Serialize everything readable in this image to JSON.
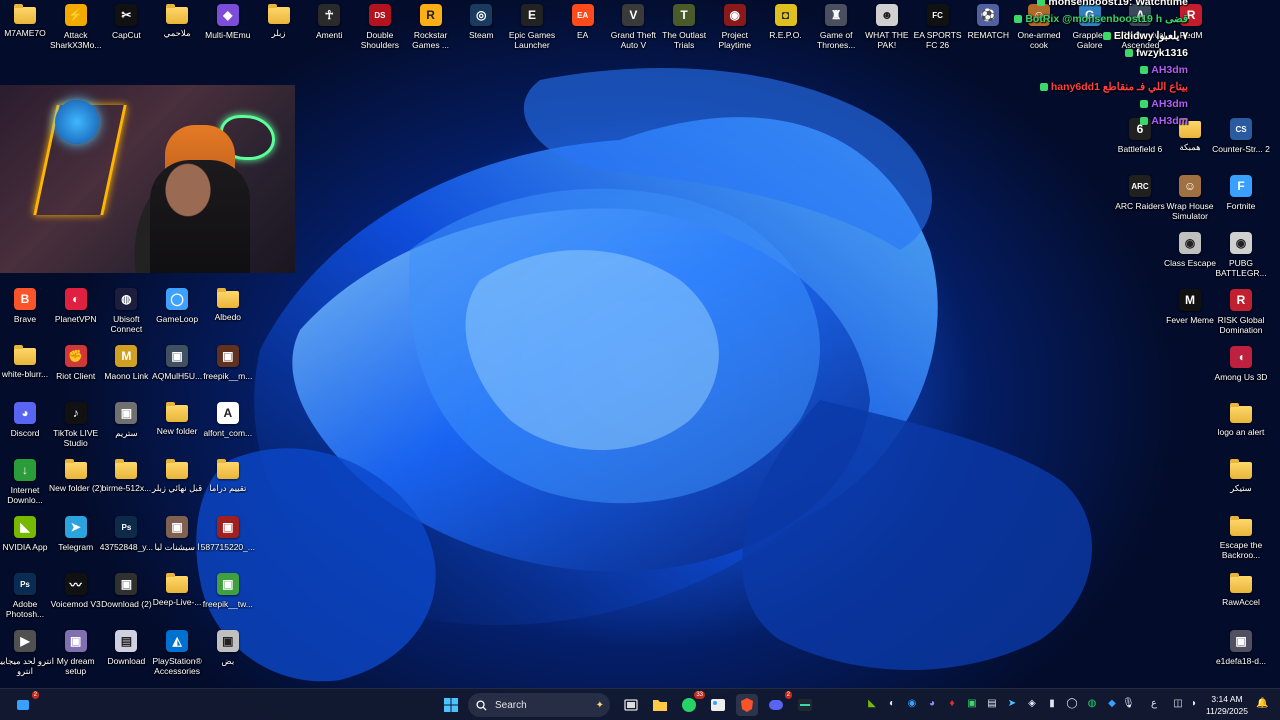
{
  "desktop": {
    "top_row": [
      {
        "label": "M7AME7O",
        "icon": "folder-icon",
        "color": "#f2c14e",
        "glyph": ""
      },
      {
        "label": "Attack SharkX3Mo...",
        "icon": "shark-icon",
        "color": "#f2a900",
        "glyph": "⚡"
      },
      {
        "label": "CapCut",
        "icon": "capcut-icon",
        "color": "#111111",
        "glyph": "✂"
      },
      {
        "label": "ملاحمي",
        "icon": "folder-icon",
        "color": "#f2c14e",
        "glyph": ""
      },
      {
        "label": "Multi-MEmu",
        "icon": "memu-icon",
        "color": "#7b4dd8",
        "glyph": "◆"
      },
      {
        "label": "زبلر",
        "icon": "folder-icon",
        "color": "#f2c14e",
        "glyph": ""
      },
      {
        "label": "Amenti",
        "icon": "game-icon",
        "color": "#2a2a2a",
        "glyph": "☥"
      },
      {
        "label": "Double Shoulders",
        "icon": "ds-icon",
        "color": "#b3121f",
        "glyph": "DS"
      },
      {
        "label": "Rockstar Games ...",
        "icon": "rockstar-icon",
        "color": "#fcaf17",
        "glyph": "R"
      },
      {
        "label": "Steam",
        "icon": "steam-icon",
        "color": "#1b3b5e",
        "glyph": "◎"
      },
      {
        "label": "Epic Games Launcher",
        "icon": "epic-icon",
        "color": "#222222",
        "glyph": "E"
      },
      {
        "label": "EA",
        "icon": "ea-icon",
        "color": "#ff4a1c",
        "glyph": "EA"
      },
      {
        "label": "Grand Theft Auto V",
        "icon": "gta-icon",
        "color": "#3a3a3a",
        "glyph": "V"
      },
      {
        "label": "The Outlast Trials",
        "icon": "outlast-icon",
        "color": "#4a5a2a",
        "glyph": "T"
      },
      {
        "label": "Project Playtime",
        "icon": "playtime-icon",
        "color": "#8a1a1a",
        "glyph": "◉"
      },
      {
        "label": "R.E.P.O.",
        "icon": "repo-icon",
        "color": "#e0c020",
        "glyph": "◘"
      },
      {
        "label": "Game of Thrones...",
        "icon": "got-icon",
        "color": "#4a5060",
        "glyph": "♜"
      },
      {
        "label": "WHAT THE PAK!",
        "icon": "pak-icon",
        "color": "#d0d0d0",
        "glyph": "☻"
      },
      {
        "label": "EA SPORTS FC 26",
        "icon": "fc-icon",
        "color": "#111111",
        "glyph": "FC"
      },
      {
        "label": "REMATCH",
        "icon": "rematch-icon",
        "color": "#5060a0",
        "glyph": "⚽"
      },
      {
        "label": "One-armed cook",
        "icon": "cook-icon",
        "color": "#b06a2a",
        "glyph": "☺"
      },
      {
        "label": "Grapples Galore",
        "icon": "grapples-icon",
        "color": "#3080c0",
        "glyph": "G"
      },
      {
        "label": "ARK Survival Ascended",
        "icon": "ark-icon",
        "color": "#3a4a5a",
        "glyph": "A"
      },
      {
        "label": "RedM",
        "icon": "redm-icon",
        "color": "#c41c2a",
        "glyph": "R"
      }
    ],
    "left_columns": [
      {
        "label": "Brave",
        "icon": "brave-icon",
        "color": "#fb542b",
        "glyph": "B"
      },
      {
        "label": "PlanetVPN",
        "icon": "planetvpn-icon",
        "color": "#e02040",
        "glyph": "◐"
      },
      {
        "label": "Ubisoft Connect",
        "icon": "ubisoft-icon",
        "color": "#1d1d3d",
        "glyph": "◍"
      },
      {
        "label": "GameLoop",
        "icon": "gameloop-icon",
        "color": "#3ea0ff",
        "glyph": "◯"
      },
      {
        "label": "Albedo",
        "icon": "folder-icon",
        "color": "#f2c14e",
        "glyph": ""
      },
      {
        "label": "white-blurr...",
        "icon": "folder-icon",
        "color": "#f2c14e",
        "glyph": ""
      },
      {
        "label": "Riot Client",
        "icon": "riot-icon",
        "color": "#d13639",
        "glyph": "✊"
      },
      {
        "label": "Maono Link",
        "icon": "maono-icon",
        "color": "#d0a020",
        "glyph": "M"
      },
      {
        "label": "AQMulH5U...",
        "icon": "image-file-icon",
        "color": "#405060",
        "glyph": "▣"
      },
      {
        "label": "freepik__m...",
        "icon": "image-file-icon",
        "color": "#603020",
        "glyph": "▣"
      },
      {
        "label": "Discord",
        "icon": "discord-icon",
        "color": "#5865f2",
        "glyph": "◕"
      },
      {
        "label": "TikTok LIVE Studio",
        "icon": "tiktok-icon",
        "color": "#111111",
        "glyph": "♪"
      },
      {
        "label": "ستريم",
        "icon": "image-file-icon",
        "color": "#707070",
        "glyph": "▣"
      },
      {
        "label": "New folder",
        "icon": "folder-icon",
        "color": "#f2c14e",
        "glyph": ""
      },
      {
        "label": "alfont_com...",
        "icon": "font-file-icon",
        "color": "#ffffff",
        "glyph": "A"
      },
      {
        "label": "Internet Downlo...",
        "icon": "idm-icon",
        "color": "#2a9d3a",
        "glyph": "↓"
      },
      {
        "label": "New folder (2)",
        "icon": "folder-icon",
        "color": "#f2c14e",
        "glyph": ""
      },
      {
        "label": "birme-512x...",
        "icon": "folder-icon",
        "color": "#f2c14e",
        "glyph": ""
      },
      {
        "label": "قبل نهائي زبلر",
        "icon": "folder-icon",
        "color": "#f2c14e",
        "glyph": ""
      },
      {
        "label": "تقييم دراما",
        "icon": "folder-icon",
        "color": "#f2c14e",
        "glyph": ""
      },
      {
        "label": "NVIDIA App",
        "icon": "nvidia-icon",
        "color": "#76b900",
        "glyph": "◣"
      },
      {
        "label": "Telegram",
        "icon": "telegram-icon",
        "color": "#2aa3df",
        "glyph": "➤"
      },
      {
        "label": "43752848_y...",
        "icon": "photoshop-file-icon",
        "color": "#0d2a4a",
        "glyph": "Ps"
      },
      {
        "label": "ا سيشنات لبا",
        "icon": "image-file-icon",
        "color": "#806050",
        "glyph": "▣"
      },
      {
        "label": "587715220_...",
        "icon": "image-file-icon",
        "color": "#a02020",
        "glyph": "▣"
      },
      {
        "label": "Adobe Photosh...",
        "icon": "photoshop-icon",
        "color": "#0a2b52",
        "glyph": "Ps"
      },
      {
        "label": "Voicemod V3",
        "icon": "voicemod-icon",
        "color": "#111111",
        "glyph": "〰"
      },
      {
        "label": "Download (2)",
        "icon": "image-file-icon",
        "color": "#303030",
        "glyph": "▣"
      },
      {
        "label": "Deep-Live-...",
        "icon": "folder-icon",
        "color": "#f2c14e",
        "glyph": ""
      },
      {
        "label": "freepik__tw...",
        "icon": "image-file-icon",
        "color": "#40a040",
        "glyph": "▣"
      },
      {
        "label": "انترو لحد ميجابيو انترو",
        "icon": "video-file-icon",
        "color": "#505050",
        "glyph": "▶"
      },
      {
        "label": "My dream setup",
        "icon": "image-file-icon",
        "color": "#8070b0",
        "glyph": "▣"
      },
      {
        "label": "Download",
        "icon": "file-icon",
        "color": "#d0d0e0",
        "glyph": "▤"
      },
      {
        "label": "PlayStation® Accessories",
        "icon": "playstation-icon",
        "color": "#0070d1",
        "glyph": "◭"
      },
      {
        "label": "بض",
        "icon": "image-file-icon",
        "color": "#c0c0c0",
        "glyph": "▣"
      }
    ],
    "right_columns": [
      {
        "label": "Battlefield 6",
        "icon": "battlefield-icon",
        "color": "#202020",
        "glyph": "6"
      },
      {
        "label": "همبكة",
        "icon": "folder-icon",
        "color": "#f2c14e",
        "glyph": ""
      },
      {
        "label": "Counter-Str... 2",
        "icon": "cs2-icon",
        "color": "#2a5aa0",
        "glyph": "CS"
      },
      {
        "label": "ARC Raiders",
        "icon": "arc-icon",
        "color": "#202020",
        "glyph": "ARC"
      },
      {
        "label": "Wrap House Simulator",
        "icon": "wrap-icon",
        "color": "#a07040",
        "glyph": "☺"
      },
      {
        "label": "Fortnite",
        "icon": "fortnite-icon",
        "color": "#3aa0ff",
        "glyph": "F"
      },
      {
        "label": "Class Escape",
        "icon": "class-escape-icon",
        "color": "#c0c0c0",
        "glyph": "◉"
      },
      {
        "label": "PUBG BATTLEGR...",
        "icon": "pubg-icon",
        "color": "#d0d0d0",
        "glyph": "◉"
      },
      {
        "label": "Fever Meme",
        "icon": "fever-icon",
        "color": "#111111",
        "glyph": "M"
      },
      {
        "label": "RISK Global Domination",
        "icon": "risk-icon",
        "color": "#c02030",
        "glyph": "R"
      },
      {
        "label": "Among Us 3D",
        "icon": "amongus-icon",
        "color": "#c02040",
        "glyph": "◖"
      },
      {
        "label": "logo an alert",
        "icon": "folder-icon",
        "color": "#f2c14e",
        "glyph": ""
      },
      {
        "label": "ستيكر",
        "icon": "folder-icon",
        "color": "#f2c14e",
        "glyph": ""
      },
      {
        "label": "Escape the Backroo...",
        "icon": "folder-icon",
        "color": "#f2c14e",
        "glyph": ""
      },
      {
        "label": "RawAccel",
        "icon": "folder-icon",
        "color": "#f2c14e",
        "glyph": ""
      },
      {
        "label": "e1defa18-d...",
        "icon": "image-file-icon",
        "color": "#505060",
        "glyph": "▣"
      }
    ]
  },
  "chat": [
    {
      "text": "mohsenboost19: Watchtime",
      "color": "#ffffff"
    },
    {
      "text": "BotRix @mohsenboost19 h قضى",
      "color": "#35d36a"
    },
    {
      "text": "Eldidwy ٧ يلعبوا",
      "color": "#ffffff"
    },
    {
      "text": "fwzyk1316",
      "color": "#ffffff"
    },
    {
      "text": "AH3dm",
      "color": "#b05cff"
    },
    {
      "text": "hany6dd1 بيتاع اللي فـ منقاطع",
      "color": "#ff4040"
    },
    {
      "text": "AH3dm",
      "color": "#b05cff"
    },
    {
      "text": "AH3dm",
      "color": "#b05cff"
    }
  ],
  "webcam": {
    "label": "webcam"
  },
  "taskbar": {
    "search_label": "Search",
    "time": "3:14 AM",
    "date": "11/29/2025",
    "whatsapp_badge": "33",
    "discord_badge": "2",
    "input_language": "ع",
    "weather_badge": "2"
  },
  "colors": {
    "accent": "#1c6cff",
    "taskbar_bg": "#121a30"
  }
}
